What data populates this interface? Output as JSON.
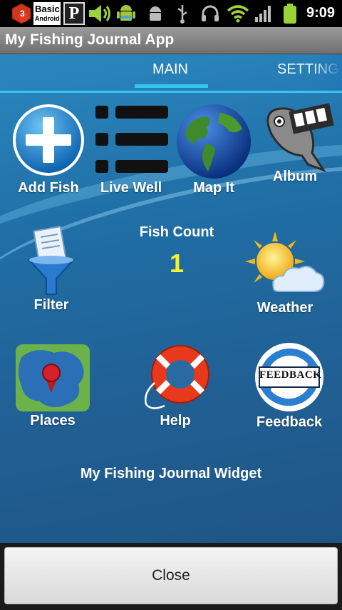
{
  "status_bar": {
    "notification_count": "3",
    "basic_android_label_1": "Basic",
    "basic_android_label_2": "Android",
    "p_label": "P",
    "time": "9:09"
  },
  "app": {
    "title": "My Fishing Journal App"
  },
  "tabs": [
    {
      "label": "MAIN"
    },
    {
      "label": "SETTINGS"
    }
  ],
  "tiles": {
    "add_fish": "Add Fish",
    "live_well": "Live Well",
    "map_it": "Map It",
    "album": "Album",
    "filter": "Filter",
    "weather": "Weather",
    "places": "Places",
    "help": "Help",
    "feedback": "Feedback",
    "feedback_badge": "FEEDBACK"
  },
  "fish_count": {
    "label": "Fish Count",
    "value": "1"
  },
  "widget": {
    "title": "My Fishing Journal Widget"
  },
  "close_button": {
    "label": "Close"
  },
  "colors": {
    "accent": "#33c7ee",
    "count": "#f6f22c",
    "background": "#1f6ea5"
  }
}
